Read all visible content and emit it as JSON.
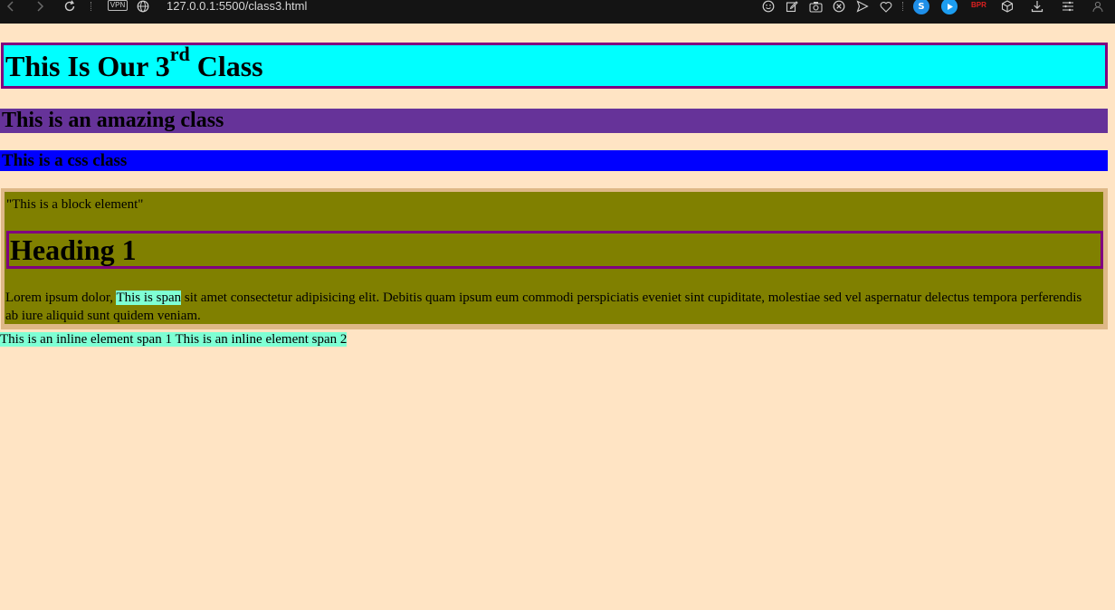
{
  "browser": {
    "url": "127.0.0.1:5500/class3.html",
    "vpn_label": "VPN",
    "extension_badge": "BPR",
    "icons": [
      "back-icon",
      "forward-icon",
      "reload-icon",
      "globe-icon",
      "emoji-icon",
      "edit-icon",
      "camera-icon",
      "close-circle-icon",
      "send-icon",
      "heart-icon",
      "extension-s-icon",
      "extension-play-icon",
      "cube-icon",
      "download-icon",
      "menu-icon",
      "profile-icon"
    ]
  },
  "page": {
    "h1_text": "This Is Our 3",
    "h1_sup": "rd",
    "h1_tail": " Class",
    "h2_text": "This is an amazing class",
    "h3_text": "This is a css class",
    "block_text": "\"This is a block element\"",
    "heading1": "Heading 1",
    "para_before": "Lorem ipsum dolor, ",
    "para_span": "This is span",
    "para_after": " sit amet consectetur adipisicing elit. Debitis quam ipsum eum commodi perspiciatis eveniet sint cupiditate, molestiae sed vel aspernatur delectus tempora perferendis ab iure aliquid sunt quidem veniam.",
    "inline_span1": "This is an inline element span 1",
    "inline_span2": "This is an inline element span 2"
  },
  "colors": {
    "page_bg": "#ffe4c4",
    "h1_bg": "#00ffff",
    "h1_border": "#800080",
    "h2_bg": "#663399",
    "h3_bg": "#0000ff",
    "outer_bg": "#deb887",
    "inner_bg": "#808000",
    "span_bg": "#7fffd4"
  }
}
